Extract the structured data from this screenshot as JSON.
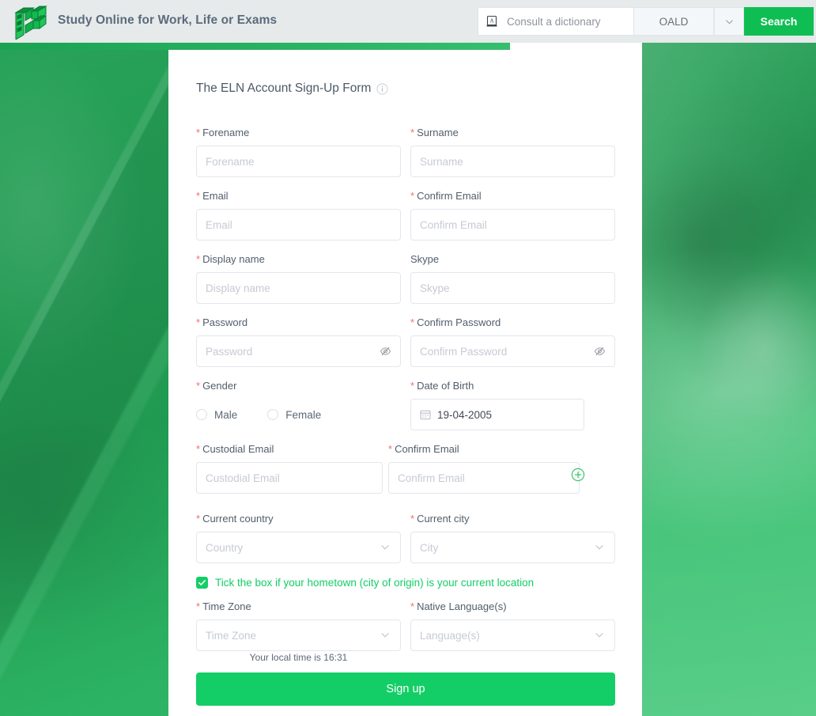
{
  "header": {
    "brand_title": "Study Online for Work, Life or Exams",
    "logo_icon": "eln-blocks-logo-icon",
    "search": {
      "dictionary_icon": "dictionary-book-icon",
      "placeholder": "Consult a dictionary",
      "value": "",
      "dictionary_selected": "OALD",
      "caret_icon": "chevron-down-icon",
      "button_label": "Search"
    },
    "accent_color": "#2bb463",
    "background_color": "#e6eaea"
  },
  "form": {
    "title": "The ELN Account Sign-Up Form",
    "info_icon": "info-circle-icon",
    "fields": {
      "forename": {
        "label": "Forename",
        "required": true,
        "placeholder": "Forename"
      },
      "surname": {
        "label": "Surname",
        "required": true,
        "placeholder": "Surname"
      },
      "email": {
        "label": "Email",
        "required": true,
        "placeholder": "Email"
      },
      "confirm_email": {
        "label": "Confirm Email",
        "required": true,
        "placeholder": "Confirm Email"
      },
      "display_name": {
        "label": "Display name",
        "required": true,
        "placeholder": "Display name"
      },
      "skype": {
        "label": "Skype",
        "required": false,
        "placeholder": "Skype"
      },
      "password": {
        "label": "Password",
        "required": true,
        "placeholder": "Password",
        "icon": "eye-slash-icon"
      },
      "confirm_password": {
        "label": "Confirm Password",
        "required": true,
        "placeholder": "Confirm Password",
        "icon": "eye-slash-icon"
      },
      "gender": {
        "label": "Gender",
        "required": true,
        "options": [
          "Male",
          "Female"
        ],
        "selected": ""
      },
      "date_of_birth": {
        "label": "Date of Birth",
        "required": true,
        "value": "19-04-2005",
        "icon": "calendar-icon"
      },
      "custodial_email": {
        "label": "Custodial Email",
        "required": true,
        "placeholder": "Custodial Email"
      },
      "custodial_confirm": {
        "label": "Confirm Email",
        "required": true,
        "placeholder": "Confirm Email"
      },
      "add_custodial": {
        "icon": "plus-circle-icon"
      },
      "current_country": {
        "label": "Current country",
        "required": true,
        "placeholder": "Country",
        "icon": "chevron-down-icon"
      },
      "current_city": {
        "label": "Current city",
        "required": true,
        "placeholder": "City",
        "icon": "chevron-down-icon"
      },
      "time_zone": {
        "label": "Time Zone",
        "required": true,
        "placeholder": "Time Zone",
        "icon": "chevron-down-icon"
      },
      "native_language": {
        "label": "Native Language(s)",
        "required": true,
        "placeholder": "Language(s)",
        "icon": "chevron-down-icon"
      }
    },
    "hometown_checkbox": {
      "checked": true,
      "label": "Tick the box if your hometown (city of origin) is your current location",
      "color": "#13ce66"
    },
    "local_time_note": "Your local time is 16:31",
    "submit_label": "Sign up",
    "submit_color": "#13ce66",
    "required_marker": "*",
    "required_color": "#f56c6c"
  },
  "background": {
    "description": "green-tinted photo of a hand writing with a pen",
    "tint_color": "#2cb563"
  }
}
